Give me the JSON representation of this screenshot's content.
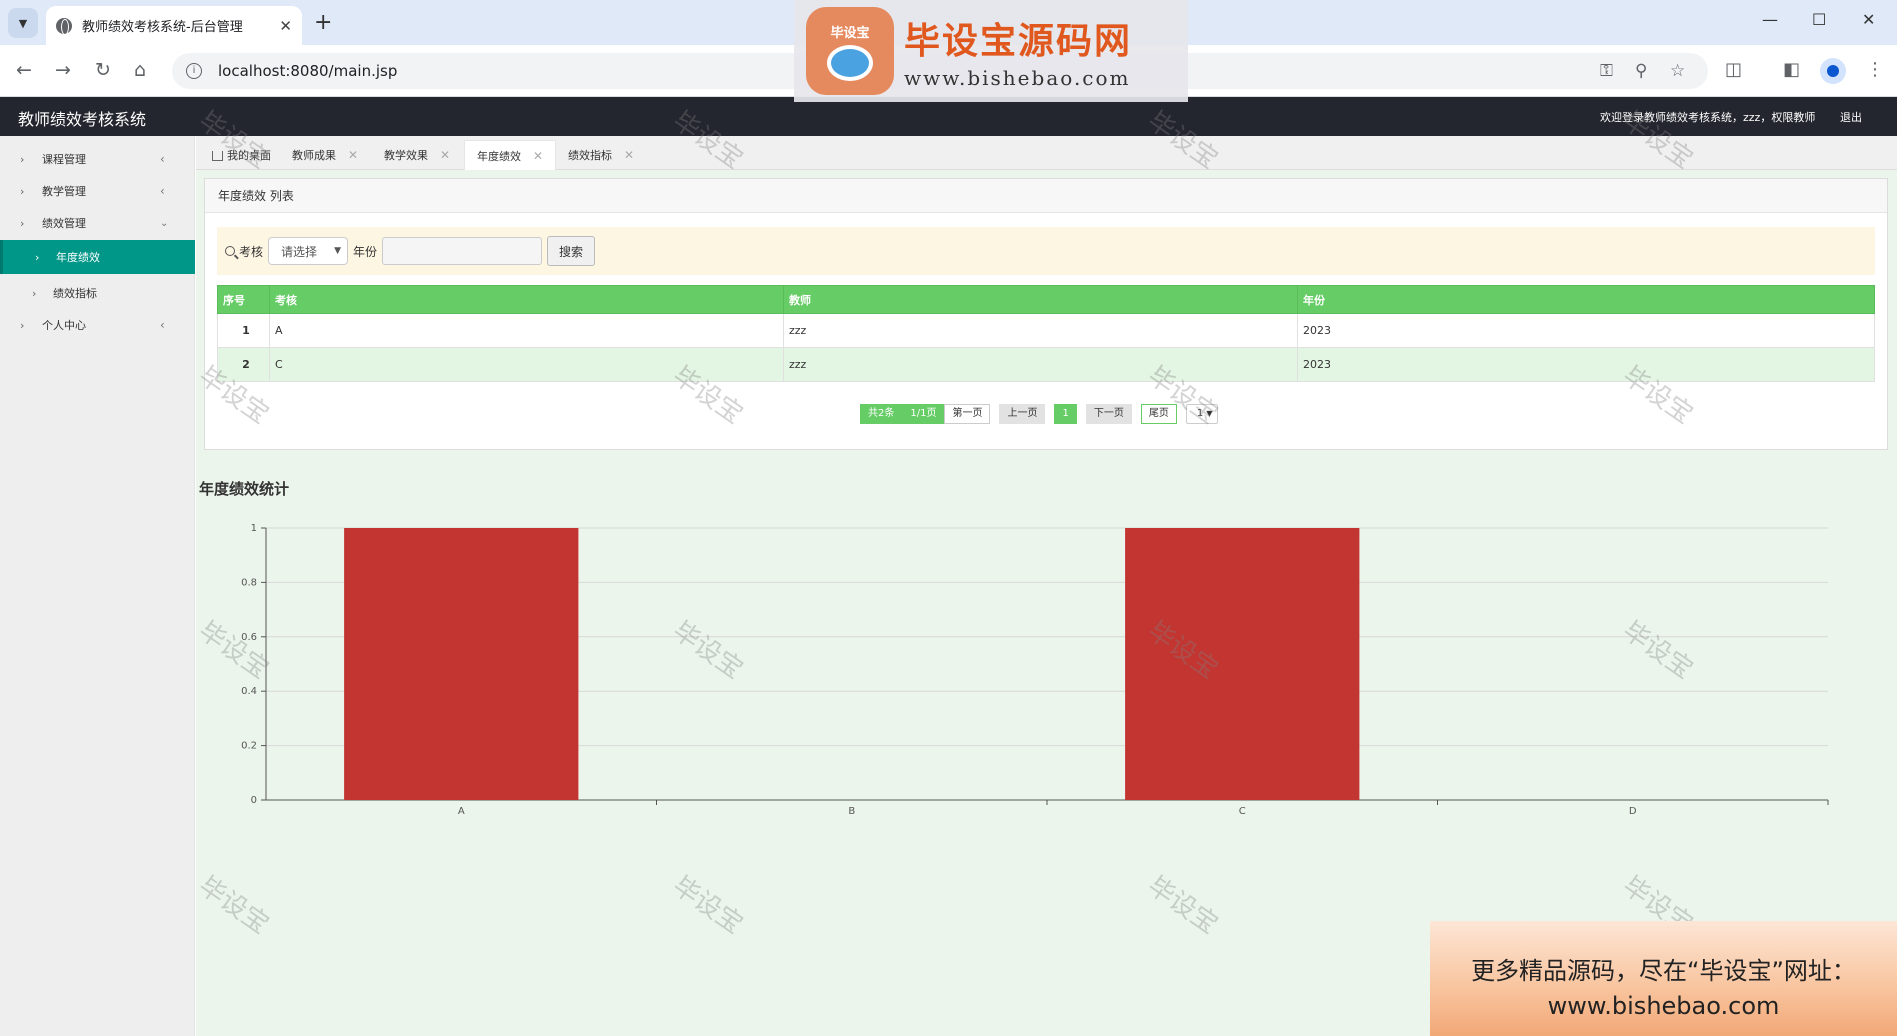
{
  "browser": {
    "tab_title": "教师绩效考核系统-后台管理",
    "url": "localhost:8080/main.jsp"
  },
  "app": {
    "title": "教师绩效考核系统",
    "welcome": "欢迎登录教师绩效考核系统，zzz，权限教师",
    "logout": "退出"
  },
  "sidebar": {
    "items": [
      {
        "label": "课程管理"
      },
      {
        "label": "教学管理"
      },
      {
        "label": "绩效管理"
      },
      {
        "label": "年度绩效"
      },
      {
        "label": "绩效指标"
      },
      {
        "label": "个人中心"
      }
    ]
  },
  "page_tabs": [
    {
      "label": "我的桌面"
    },
    {
      "label": "教师成果"
    },
    {
      "label": "教学效果"
    },
    {
      "label": "年度绩效"
    },
    {
      "label": "绩效指标"
    }
  ],
  "panel": {
    "title": "年度绩效 列表",
    "search": {
      "label_kaohe": "考核",
      "select_value": "请选择",
      "label_year": "年份",
      "button": "搜索"
    },
    "table": {
      "headers": [
        "序号",
        "考核",
        "教师",
        "年份"
      ],
      "rows": [
        [
          "1",
          "A",
          "zzz",
          "2023"
        ],
        [
          "2",
          "C",
          "zzz",
          "2023"
        ]
      ]
    },
    "pager": {
      "total": "共2条",
      "pages": "1/1页",
      "first": "第一页",
      "prev": "上一页",
      "current": "1",
      "next": "下一页",
      "last": "尾页",
      "jump": "1"
    }
  },
  "chart_title": "年度绩效统计",
  "chart_data": {
    "type": "bar",
    "categories": [
      "A",
      "B",
      "C",
      "D"
    ],
    "values": [
      1,
      0,
      1,
      0
    ],
    "ylim": [
      0,
      1
    ],
    "yticks": [
      0,
      0.2,
      0.4,
      0.6,
      0.8,
      1
    ],
    "bar_color": "#c23531",
    "grid": true
  },
  "watermark": {
    "logo_badge": "毕设宝",
    "logo_name": "毕设宝源码网",
    "logo_url": "www.bishebao.com",
    "stamp": "毕设宝",
    "promo_line1": "更多精品源码，尽在“毕设宝”网址：",
    "promo_line2": "www.bishebao.com"
  },
  "colors": {
    "sidebar_active": "#009688",
    "table_header": "#66cc66",
    "header_bg": "#23262e"
  }
}
